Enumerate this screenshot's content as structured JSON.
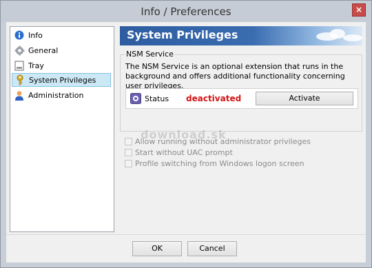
{
  "window": {
    "title": "Info / Preferences",
    "close_glyph": "×"
  },
  "sidebar": {
    "items": [
      {
        "label": "Info",
        "icon": "info-icon"
      },
      {
        "label": "General",
        "icon": "gear-icon"
      },
      {
        "label": "Tray",
        "icon": "tray-icon"
      },
      {
        "label": "System Privileges",
        "icon": "key-icon",
        "selected": true
      },
      {
        "label": "Administration",
        "icon": "user-icon"
      }
    ]
  },
  "header": {
    "title": "System Privileges"
  },
  "nsm": {
    "group_label": "NSM Service",
    "description": "The NSM Service is an optional extension that runs in the background and offers additional functionality concerning user privileges.",
    "status_label": "Status",
    "status_value": "deactivated",
    "status_color": "#d41414",
    "activate_label": "Activate"
  },
  "options": [
    {
      "label": "Allow running without administrator privileges",
      "checked": false,
      "enabled": false
    },
    {
      "label": "Start without UAC prompt",
      "checked": false,
      "enabled": false
    },
    {
      "label": "Profile switching from Windows logon screen",
      "checked": false,
      "enabled": false
    }
  ],
  "watermark": "download.sk",
  "buttons": {
    "ok": "OK",
    "cancel": "Cancel"
  }
}
